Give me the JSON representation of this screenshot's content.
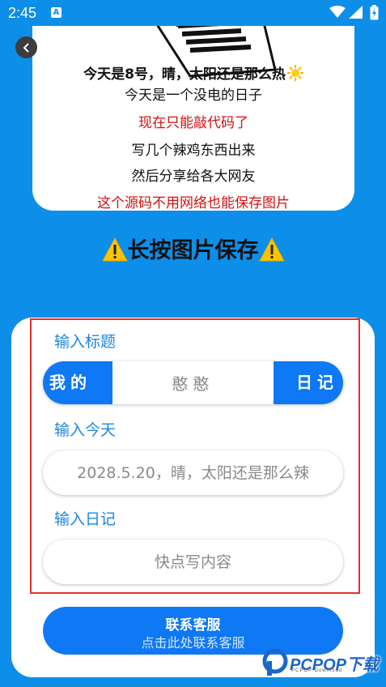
{
  "status_bar": {
    "time": "2:45",
    "notification_icon": "A"
  },
  "image_card": {
    "lines": [
      "今天是8号，晴，太阳还是那么热",
      "今天是一个没电的日子",
      "现在只能敲代码了",
      "写几个辣鸡东西出来",
      "然后分享给各大网友",
      "这个源码不用网络也能保存图片"
    ],
    "colors": {
      "red": "#d40f0f",
      "black": "#111111"
    }
  },
  "save_hint": "长按图片保存",
  "form": {
    "title_label": "输入标题",
    "title_left": "我的",
    "title_value": "憨憨",
    "title_right": "日记",
    "today_label": "输入今天",
    "today_placeholder": "2028.5.20，晴，太阳还是那么辣",
    "diary_label": "输入日记",
    "diary_placeholder": "快点写内容"
  },
  "contact": {
    "title": "联系客服",
    "subtitle": "点击此处联系客服"
  },
  "watermark": {
    "brand": "PCPOP下载",
    "sub": "PCPOP Download"
  },
  "theme": {
    "background": "#0d8ee8",
    "accent": "#0e78f5",
    "label_blue": "#1a87e5",
    "frame_red": "#e8302c"
  }
}
